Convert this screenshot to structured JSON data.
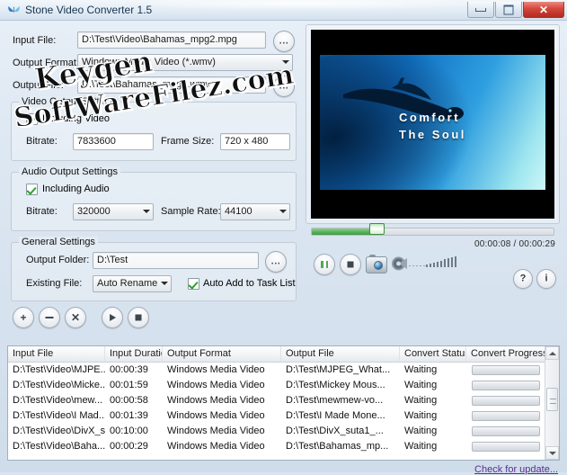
{
  "window": {
    "title": "Stone Video Converter 1.5",
    "icon": "butterfly-icon",
    "minimize_label": "Minimize",
    "maximize_label": "Maximize",
    "close_label": "Close"
  },
  "watermark": {
    "line1": "Keygen",
    "line2": "SoftWareFilez.com"
  },
  "file_section": {
    "input_file_label": "Input File:",
    "input_file_value": "D:\\Test\\Video\\Bahamas_mpg2.mpg",
    "output_format_label": "Output Format:",
    "output_format_value": "Windows Media Video (*.wmv)",
    "output_file_label": "Output File:",
    "output_file_value": "D:\\Test\\Bahamas_mpg2.wmv",
    "browse_label": "..."
  },
  "video_settings": {
    "title": "Video Output Settings",
    "including_video_label": "Including Video",
    "including_video_checked": true,
    "bitrate_label": "Bitrate:",
    "bitrate_value": "7833600",
    "frame_size_label": "Frame Size:",
    "frame_size_value": "720 x 480"
  },
  "audio_settings": {
    "title": "Audio Output Settings",
    "including_audio_label": "Including Audio",
    "including_audio_checked": true,
    "bitrate_label": "Bitrate:",
    "bitrate_value": "320000",
    "sample_rate_label": "Sample Rate:",
    "sample_rate_value": "44100"
  },
  "general_settings": {
    "title": "General Settings",
    "output_folder_label": "Output Folder:",
    "output_folder_value": "D:\\Test",
    "existing_file_label": "Existing File:",
    "existing_file_value": "Auto Rename",
    "auto_add_label": "Auto Add to Task List",
    "auto_add_checked": true,
    "browse_label": "..."
  },
  "task_toolbar": {
    "add_label": "+",
    "remove_label": "–",
    "clear_label": "✕",
    "start_label": "Start",
    "stop_label": "Stop"
  },
  "help_toolbar": {
    "help_label": "?",
    "about_label": "i"
  },
  "preview": {
    "video_text_line1": "Comfort",
    "video_text_line2": "The Soul",
    "time_display": "00:00:08 / 00:00:29",
    "progress_percent": 27,
    "pause_label": "Pause",
    "stop_label": "Stop",
    "snapshot_label": "Snapshot",
    "volume_label": "Volume"
  },
  "task_list": {
    "columns": [
      "Input File",
      "Input Duration",
      "Output Format",
      "Output File",
      "Convert Status",
      "Convert Progress"
    ],
    "rows": [
      {
        "input_file": "D:\\Test\\Video\\MJPE...",
        "input_duration": "00:00:39",
        "output_format": "Windows Media Video",
        "output_file": "D:\\Test\\MJPEG_What...",
        "convert_status": "Waiting",
        "convert_progress": 0
      },
      {
        "input_file": "D:\\Test\\Video\\Micke...",
        "input_duration": "00:01:59",
        "output_format": "Windows Media Video",
        "output_file": "D:\\Test\\Mickey Mous...",
        "convert_status": "Waiting",
        "convert_progress": 0
      },
      {
        "input_file": "D:\\Test\\Video\\mew...",
        "input_duration": "00:00:58",
        "output_format": "Windows Media Video",
        "output_file": "D:\\Test\\mewmew-vo...",
        "convert_status": "Waiting",
        "convert_progress": 0
      },
      {
        "input_file": "D:\\Test\\Video\\I Mad...",
        "input_duration": "00:01:39",
        "output_format": "Windows Media Video",
        "output_file": "D:\\Test\\I Made Mone...",
        "convert_status": "Waiting",
        "convert_progress": 0
      },
      {
        "input_file": "D:\\Test\\Video\\DivX_s...",
        "input_duration": "00:10:00",
        "output_format": "Windows Media Video",
        "output_file": "D:\\Test\\DivX_suta1_...",
        "convert_status": "Waiting",
        "convert_progress": 0
      },
      {
        "input_file": "D:\\Test\\Video\\Baha...",
        "input_duration": "00:00:29",
        "output_format": "Windows Media Video",
        "output_file": "D:\\Test\\Bahamas_mp...",
        "convert_status": "Waiting",
        "convert_progress": 0
      }
    ]
  },
  "footer": {
    "update_link": "Check for update..."
  },
  "colors": {
    "accent_green": "#59b259",
    "link_purple": "#5b2d8f",
    "close_red": "#d4473c",
    "title_blue": "#17334f"
  }
}
